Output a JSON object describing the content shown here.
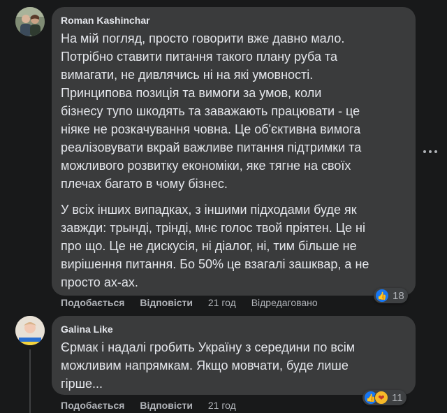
{
  "comments": [
    {
      "author": "Roman Kashinchar",
      "paragraphs": [
        "На мій погляд, просто говорити вже давно мало.\nПотрібно ставити питання такого плану руба та\nвимагати, не дивлячись ні на які умовності.\nПринципова позиція та вимоги за умов, коли\nбізнесу тупо шкодять та заважають працювати - це\nніяке не розкачування човна. Це об'єктивна вимога\nреалізовувати вкрай важливе питання підтримки та\nможливого розвитку економіки, яке тягне на своїх\nплечах багато в чому бізнес.",
        "У всіх інших випадках, з іншими підходами буде як\nзавжди: трынді, трінді, мнє голос твой прiятен. Це ні\nпро що. Це не дискусія, ні діалог, ні, тим більше не\nвирішення питання. Бо 50% це взагалі зашквар, а не\nпросто ах-ах."
      ],
      "actions": {
        "like": "Подобається",
        "reply": "Відповісти",
        "time": "21 год",
        "edited": "Відредаговано"
      },
      "reactions": {
        "icons": [
          "like-icon"
        ],
        "count": "18"
      }
    },
    {
      "author": "Galina Like",
      "paragraphs": [
        "Єрмак і надалі гробить Україну з середини по всім\nможливим напрямкам. Якщо мовчати, буде лише\nгірше..."
      ],
      "actions": {
        "like": "Подобається",
        "reply": "Відповісти",
        "time": "21 год"
      },
      "reactions": {
        "icons": [
          "like-icon",
          "care-icon"
        ],
        "count": "11"
      }
    }
  ],
  "colors": {
    "background": "#18191a",
    "bubble": "#3a3b3c",
    "text": "#e4e6eb",
    "secondary_text": "#b0b3b8",
    "like_blue": "#1877f2"
  }
}
